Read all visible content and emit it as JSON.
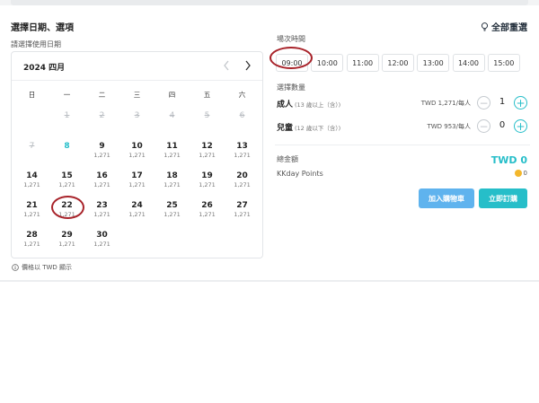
{
  "header": {
    "title": "選擇日期、選項",
    "reset_label": "全部重選"
  },
  "calendar": {
    "prompt": "請選擇使用日期",
    "month": "2024 四月",
    "weekdays": [
      "日",
      "一",
      "二",
      "三",
      "四",
      "五",
      "六"
    ],
    "days": [
      {
        "d": "1",
        "p": "",
        "past": true
      },
      {
        "d": "2",
        "p": "",
        "past": true
      },
      {
        "d": "3",
        "p": "",
        "past": true
      },
      {
        "d": "4",
        "p": "",
        "past": true
      },
      {
        "d": "5",
        "p": "",
        "past": true
      },
      {
        "d": "6",
        "p": "",
        "past": true
      },
      {
        "d": "7",
        "p": "",
        "past": true
      },
      {
        "d": "8",
        "p": "",
        "today": true
      },
      {
        "d": "9",
        "p": "1,271"
      },
      {
        "d": "10",
        "p": "1,271"
      },
      {
        "d": "11",
        "p": "1,271"
      },
      {
        "d": "12",
        "p": "1,271"
      },
      {
        "d": "13",
        "p": "1,271"
      },
      {
        "d": "14",
        "p": "1,271"
      },
      {
        "d": "15",
        "p": "1,271"
      },
      {
        "d": "16",
        "p": "1,271"
      },
      {
        "d": "17",
        "p": "1,271"
      },
      {
        "d": "18",
        "p": "1,271"
      },
      {
        "d": "19",
        "p": "1,271"
      },
      {
        "d": "20",
        "p": "1,271"
      },
      {
        "d": "21",
        "p": "1,271"
      },
      {
        "d": "22",
        "p": "1,271",
        "circled": true
      },
      {
        "d": "23",
        "p": "1,271"
      },
      {
        "d": "24",
        "p": "1,271"
      },
      {
        "d": "25",
        "p": "1,271"
      },
      {
        "d": "26",
        "p": "1,271"
      },
      {
        "d": "27",
        "p": "1,271"
      },
      {
        "d": "28",
        "p": "1,271"
      },
      {
        "d": "29",
        "p": "1,271"
      },
      {
        "d": "30",
        "p": "1,271"
      }
    ],
    "currency_note": "價格以 TWD 顯示"
  },
  "times": {
    "label": "場次時間",
    "slots": [
      "09:00",
      "10:00",
      "11:00",
      "12:00",
      "13:00",
      "14:00",
      "15:00"
    ],
    "selected": "09:00"
  },
  "quantity": {
    "label": "選擇數量",
    "rows": [
      {
        "name": "成人",
        "sub": "(13 歲以上（含）)",
        "price": "TWD 1,271/每人",
        "value": "1"
      },
      {
        "name": "兒童",
        "sub": "(12 歲以下（含）)",
        "price": "TWD 953/每人",
        "value": "0"
      }
    ]
  },
  "summary": {
    "total_label": "總金額",
    "total_value": "TWD 0",
    "points_label": "KKday Points",
    "points_value": "0"
  },
  "actions": {
    "cart_label": "加入購物車",
    "book_label": "立即訂購"
  },
  "colors": {
    "accent": "#26bec9",
    "cart_button": "#5fb3ee",
    "annotation_ring": "#a8232a"
  }
}
